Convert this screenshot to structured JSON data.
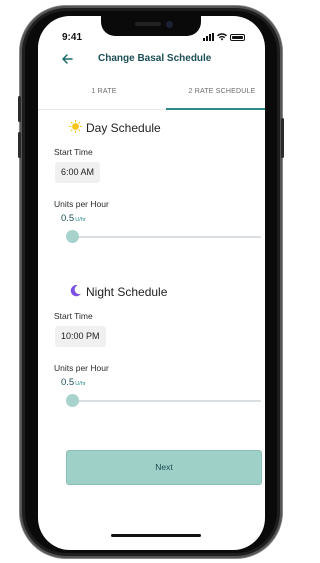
{
  "status_bar": {
    "time": "9:41"
  },
  "header": {
    "title": "Change Basal Schedule",
    "back_icon": "arrow-left-icon"
  },
  "tabs": [
    {
      "label": "1 RATE",
      "selected": false
    },
    {
      "label": "2 RATE SCHEDULE",
      "selected": true
    }
  ],
  "day": {
    "title": "Day Schedule",
    "icon": "sun-icon",
    "start_time_label": "Start Time",
    "start_time": "6:00 AM",
    "rate_label": "Units per Hour",
    "rate_value": "0.5",
    "rate_unit": "U/hr",
    "slider_level": 0
  },
  "night": {
    "title": "Night Schedule",
    "icon": "moon-icon",
    "start_time_label": "Start Time",
    "start_time": "10:00 PM",
    "rate_label": "Units per Hour",
    "rate_value": "0.5",
    "rate_unit": "U/hr",
    "slider_level": 0
  },
  "next_button": {
    "label": "Next"
  },
  "colors": {
    "accent": "#2c8a8a",
    "title": "#1b4e55",
    "button_bg": "#9fd0c7",
    "slider_thumb": "#a7d3cc",
    "sun": "#f5c518",
    "moon": "#7b4fe0"
  }
}
